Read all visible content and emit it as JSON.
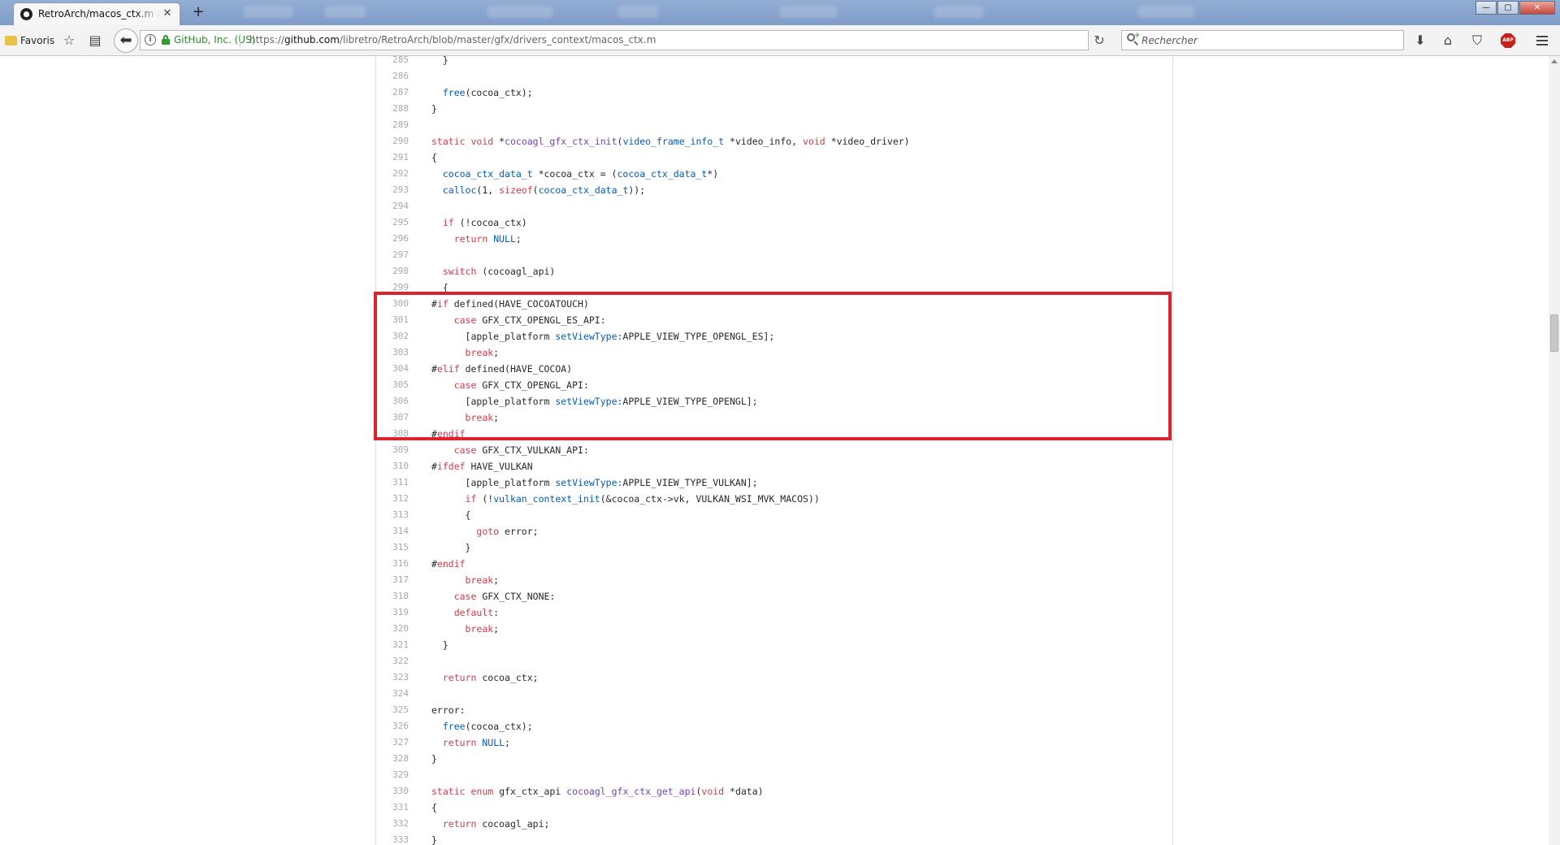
{
  "browser": {
    "tab": {
      "title": "RetroArch/macos_ctx.m at master · libretro/RetroArch",
      "close_glyph": "✕"
    },
    "new_tab_glyph": "+",
    "window_controls": {
      "minimize": "—",
      "maximize": "▢",
      "close": "✕"
    },
    "bookmarks_label": "Favoris",
    "identity": "GitHub, Inc. (US)",
    "url_scheme": "https://",
    "url_host": "github.com",
    "url_path": "/libretro/RetroArch/blob/master/gfx/drivers_context/macos_ctx.m",
    "search_placeholder": "Rechercher",
    "adblock_label": "ABP",
    "icons": [
      "folder-icon",
      "star-icon",
      "reader-icon",
      "back-arrow-icon",
      "info-icon",
      "lock-icon",
      "reload-icon",
      "search-icon",
      "download-icon",
      "home-icon",
      "pocket-icon",
      "adblock-icon",
      "menu-icon"
    ]
  },
  "code": {
    "highlight_color": "#d9232e",
    "lines": [
      {
        "num": "285",
        "segs": [
          {
            "t": "  }"
          }
        ]
      },
      {
        "num": "286",
        "segs": []
      },
      {
        "num": "287",
        "segs": [
          {
            "t": "  "
          },
          {
            "t": "free",
            "c": "c"
          },
          {
            "t": "(cocoa_ctx);"
          }
        ]
      },
      {
        "num": "288",
        "segs": [
          {
            "t": "}"
          }
        ]
      },
      {
        "num": "289",
        "segs": []
      },
      {
        "num": "290",
        "segs": [
          {
            "t": "static",
            "c": "k"
          },
          {
            "t": " "
          },
          {
            "t": "void",
            "c": "k"
          },
          {
            "t": " *"
          },
          {
            "t": "cocoagl_gfx_ctx_init",
            "c": "e"
          },
          {
            "t": "("
          },
          {
            "t": "video_frame_info_t",
            "c": "c"
          },
          {
            "t": " *video_info, "
          },
          {
            "t": "void",
            "c": "k"
          },
          {
            "t": " *video_driver)"
          }
        ]
      },
      {
        "num": "291",
        "segs": [
          {
            "t": "{"
          }
        ]
      },
      {
        "num": "292",
        "segs": [
          {
            "t": "  "
          },
          {
            "t": "cocoa_ctx_data_t",
            "c": "c"
          },
          {
            "t": " *cocoa_ctx = ("
          },
          {
            "t": "cocoa_ctx_data_t",
            "c": "c"
          },
          {
            "t": "*)"
          }
        ]
      },
      {
        "num": "293",
        "segs": [
          {
            "t": "  "
          },
          {
            "t": "calloc",
            "c": "c"
          },
          {
            "t": "(1, "
          },
          {
            "t": "sizeof",
            "c": "k"
          },
          {
            "t": "("
          },
          {
            "t": "cocoa_ctx_data_t",
            "c": "c"
          },
          {
            "t": "));"
          }
        ]
      },
      {
        "num": "294",
        "segs": []
      },
      {
        "num": "295",
        "segs": [
          {
            "t": "  "
          },
          {
            "t": "if",
            "c": "k"
          },
          {
            "t": " (!cocoa_ctx)"
          }
        ]
      },
      {
        "num": "296",
        "segs": [
          {
            "t": "    "
          },
          {
            "t": "return",
            "c": "k"
          },
          {
            "t": " "
          },
          {
            "t": "NULL",
            "c": "c"
          },
          {
            "t": ";"
          }
        ]
      },
      {
        "num": "297",
        "segs": []
      },
      {
        "num": "298",
        "segs": [
          {
            "t": "  "
          },
          {
            "t": "switch",
            "c": "k"
          },
          {
            "t": " (cocoagl_api)"
          }
        ]
      },
      {
        "num": "299",
        "segs": [
          {
            "t": "  {"
          }
        ]
      },
      {
        "num": "300",
        "segs": [
          {
            "t": "#"
          },
          {
            "t": "if",
            "c": "k"
          },
          {
            "t": " defined(HAVE_COCOATOUCH)"
          }
        ]
      },
      {
        "num": "301",
        "segs": [
          {
            "t": "    "
          },
          {
            "t": "case",
            "c": "k"
          },
          {
            "t": " GFX_CTX_OPENGL_ES_API:"
          }
        ]
      },
      {
        "num": "302",
        "segs": [
          {
            "t": "      [apple_platform "
          },
          {
            "t": "setViewType:",
            "c": "c"
          },
          {
            "t": "APPLE_VIEW_TYPE_OPENGL_ES];"
          }
        ]
      },
      {
        "num": "303",
        "segs": [
          {
            "t": "      "
          },
          {
            "t": "break",
            "c": "k"
          },
          {
            "t": ";"
          }
        ]
      },
      {
        "num": "304",
        "segs": [
          {
            "t": "#"
          },
          {
            "t": "elif",
            "c": "k"
          },
          {
            "t": " defined(HAVE_COCOA)"
          }
        ]
      },
      {
        "num": "305",
        "segs": [
          {
            "t": "    "
          },
          {
            "t": "case",
            "c": "k"
          },
          {
            "t": " GFX_CTX_OPENGL_API:"
          }
        ]
      },
      {
        "num": "306",
        "segs": [
          {
            "t": "      [apple_platform "
          },
          {
            "t": "setViewType:",
            "c": "c"
          },
          {
            "t": "APPLE_VIEW_TYPE_OPENGL];"
          }
        ]
      },
      {
        "num": "307",
        "segs": [
          {
            "t": "      "
          },
          {
            "t": "break",
            "c": "k"
          },
          {
            "t": ";"
          }
        ]
      },
      {
        "num": "308",
        "segs": [
          {
            "t": "#"
          },
          {
            "t": "endif",
            "c": "k"
          }
        ]
      },
      {
        "num": "309",
        "segs": [
          {
            "t": "    "
          },
          {
            "t": "case",
            "c": "k"
          },
          {
            "t": " GFX_CTX_VULKAN_API:"
          }
        ]
      },
      {
        "num": "310",
        "segs": [
          {
            "t": "#"
          },
          {
            "t": "ifdef",
            "c": "k"
          },
          {
            "t": " HAVE_VULKAN"
          }
        ]
      },
      {
        "num": "311",
        "segs": [
          {
            "t": "      [apple_platform "
          },
          {
            "t": "setViewType:",
            "c": "c"
          },
          {
            "t": "APPLE_VIEW_TYPE_VULKAN];"
          }
        ]
      },
      {
        "num": "312",
        "segs": [
          {
            "t": "      "
          },
          {
            "t": "if",
            "c": "k"
          },
          {
            "t": " (!"
          },
          {
            "t": "vulkan_context_init",
            "c": "c"
          },
          {
            "t": "(&cocoa_ctx->vk, VULKAN_WSI_MVK_MACOS))"
          }
        ]
      },
      {
        "num": "313",
        "segs": [
          {
            "t": "      {"
          }
        ]
      },
      {
        "num": "314",
        "segs": [
          {
            "t": "        "
          },
          {
            "t": "goto",
            "c": "k"
          },
          {
            "t": " error;"
          }
        ]
      },
      {
        "num": "315",
        "segs": [
          {
            "t": "      }"
          }
        ]
      },
      {
        "num": "316",
        "segs": [
          {
            "t": "#"
          },
          {
            "t": "endif",
            "c": "k"
          }
        ]
      },
      {
        "num": "317",
        "segs": [
          {
            "t": "      "
          },
          {
            "t": "break",
            "c": "k"
          },
          {
            "t": ";"
          }
        ]
      },
      {
        "num": "318",
        "segs": [
          {
            "t": "    "
          },
          {
            "t": "case",
            "c": "k"
          },
          {
            "t": " GFX_CTX_NONE:"
          }
        ]
      },
      {
        "num": "319",
        "segs": [
          {
            "t": "    "
          },
          {
            "t": "default",
            "c": "k"
          },
          {
            "t": ":"
          }
        ]
      },
      {
        "num": "320",
        "segs": [
          {
            "t": "      "
          },
          {
            "t": "break",
            "c": "k"
          },
          {
            "t": ";"
          }
        ]
      },
      {
        "num": "321",
        "segs": [
          {
            "t": "  }"
          }
        ]
      },
      {
        "num": "322",
        "segs": []
      },
      {
        "num": "323",
        "segs": [
          {
            "t": "  "
          },
          {
            "t": "return",
            "c": "k"
          },
          {
            "t": " cocoa_ctx;"
          }
        ]
      },
      {
        "num": "324",
        "segs": []
      },
      {
        "num": "325",
        "segs": [
          {
            "t": "error:"
          }
        ]
      },
      {
        "num": "326",
        "segs": [
          {
            "t": "  "
          },
          {
            "t": "free",
            "c": "c"
          },
          {
            "t": "(cocoa_ctx);"
          }
        ]
      },
      {
        "num": "327",
        "segs": [
          {
            "t": "  "
          },
          {
            "t": "return",
            "c": "k"
          },
          {
            "t": " "
          },
          {
            "t": "NULL",
            "c": "c"
          },
          {
            "t": ";"
          }
        ]
      },
      {
        "num": "328",
        "segs": [
          {
            "t": "}"
          }
        ]
      },
      {
        "num": "329",
        "segs": []
      },
      {
        "num": "330",
        "segs": [
          {
            "t": "static",
            "c": "k"
          },
          {
            "t": " "
          },
          {
            "t": "enum",
            "c": "k"
          },
          {
            "t": " gfx_ctx_api "
          },
          {
            "t": "cocoagl_gfx_ctx_get_api",
            "c": "e"
          },
          {
            "t": "("
          },
          {
            "t": "void",
            "c": "k"
          },
          {
            "t": " *data)"
          }
        ]
      },
      {
        "num": "331",
        "segs": [
          {
            "t": "{"
          }
        ]
      },
      {
        "num": "332",
        "segs": [
          {
            "t": "  "
          },
          {
            "t": "return",
            "c": "k"
          },
          {
            "t": " cocoagl_api;"
          }
        ]
      },
      {
        "num": "333",
        "segs": [
          {
            "t": "}"
          }
        ]
      }
    ]
  }
}
